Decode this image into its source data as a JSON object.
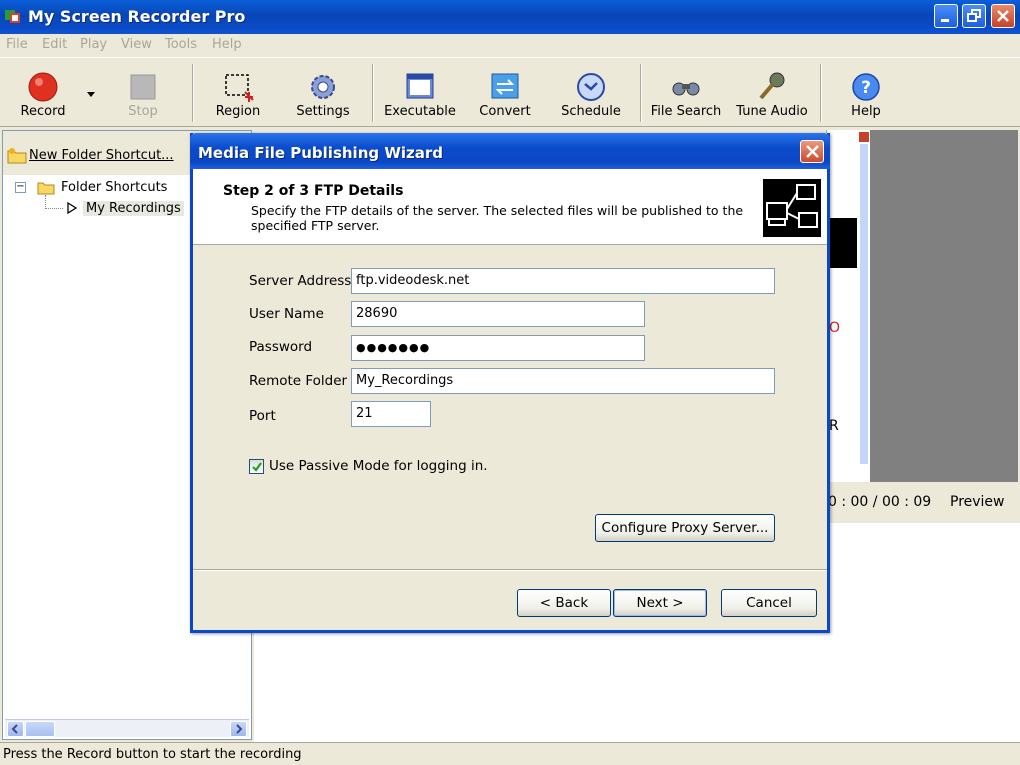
{
  "app": {
    "title": "My Screen Recorder Pro",
    "menu": [
      "File",
      "Edit",
      "Play",
      "View",
      "Tools",
      "Help"
    ]
  },
  "toolbar": {
    "record": "Record",
    "stop": "Stop",
    "region": "Region",
    "settings": "Settings",
    "executable": "Executable",
    "convert": "Convert",
    "schedule": "Schedule",
    "file_search": "File Search",
    "tune_audio": "Tune Audio",
    "help": "Help"
  },
  "left_panel": {
    "new_folder_link": "New Folder Shortcut...",
    "tree_root": "Folder Shortcuts",
    "tree_child": "My Recordings"
  },
  "preview": {
    "time": "0 : 00 / 00 : 09",
    "label": "Preview",
    "behind_text": [
      "O",
      "R"
    ]
  },
  "status": "Press the Record button to start the recording",
  "dialog": {
    "title": "Media File Publishing Wizard",
    "step": "Step 2 of 3 FTP Details",
    "description": "Specify the FTP details of the server. The selected files will be published to the specified FTP server.",
    "fields": {
      "server_label": "Server Address",
      "server_value": "ftp.videodesk.net",
      "user_label": "User Name",
      "user_value": "28690",
      "password_label": "Password",
      "password_value": "●●●●●●●",
      "folder_label": "Remote Folder",
      "folder_value": "My_Recordings",
      "port_label": "Port",
      "port_value": "21"
    },
    "passive_mode_label": "Use Passive Mode for logging in.",
    "passive_mode_checked": true,
    "proxy_button": "Configure Proxy Server...",
    "back_button": "< Back",
    "next_button": "Next >",
    "cancel_button": "Cancel"
  },
  "colors": {
    "title_blue": "#0a4ac4",
    "window_bg": "#ece9d8",
    "record_red": "#e03020"
  }
}
